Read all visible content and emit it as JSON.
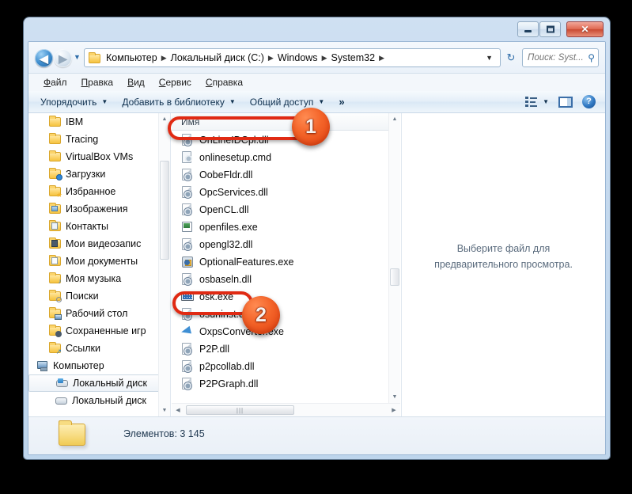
{
  "window": {
    "controls": {
      "minimize_label": "—",
      "maximize_label": "□",
      "close_label": "✕"
    }
  },
  "address_bar": {
    "back_label": "◀",
    "forward_label": "▶",
    "recent_label": "▼",
    "dropdown_label": "▼",
    "refresh_label": "↻",
    "breadcrumbs": [
      "Компьютер",
      "Локальный диск (C:)",
      "Windows",
      "System32"
    ],
    "separator": "▶",
    "search": {
      "placeholder": "Поиск: Syst...",
      "value": "",
      "icon": "search-icon"
    }
  },
  "menu": {
    "items": [
      {
        "accel": "Ф",
        "rest": "айл"
      },
      {
        "accel": "П",
        "rest": "равка"
      },
      {
        "accel": "В",
        "rest": "ид"
      },
      {
        "accel": "С",
        "rest": "ервис"
      },
      {
        "accel": "С",
        "rest": "правка"
      }
    ]
  },
  "toolbar": {
    "organize_label": "Упорядочить",
    "add_to_library_label": "Добавить в библиотеку",
    "share_label": "Общий доступ",
    "overflow_label": "»",
    "caret": "▼",
    "view_icon": "view-list-icon",
    "view_caret": "▼",
    "preview_pane_icon": "preview-pane-icon",
    "help_icon": "help-icon",
    "help_glyph": "?"
  },
  "nav_pane": {
    "items": [
      {
        "label": "IBM",
        "icon": "folder-icon",
        "indent": 1,
        "selected": false
      },
      {
        "label": "Tracing",
        "icon": "folder-icon",
        "indent": 1,
        "selected": false
      },
      {
        "label": "VirtualBox VMs",
        "icon": "folder-icon",
        "indent": 1,
        "selected": false
      },
      {
        "label": "Загрузки",
        "icon": "folder-downloads-icon",
        "indent": 1,
        "selected": false
      },
      {
        "label": "Избранное",
        "icon": "folder-favorites-icon",
        "indent": 1,
        "selected": false
      },
      {
        "label": "Изображения",
        "icon": "folder-pictures-icon",
        "indent": 1,
        "selected": false
      },
      {
        "label": "Контакты",
        "icon": "folder-contacts-icon",
        "indent": 1,
        "selected": false
      },
      {
        "label": "Мои видеозапис",
        "icon": "folder-videos-icon",
        "indent": 1,
        "selected": false
      },
      {
        "label": "Мои документы",
        "icon": "folder-documents-icon",
        "indent": 1,
        "selected": false
      },
      {
        "label": "Моя музыка",
        "icon": "folder-music-icon",
        "indent": 1,
        "selected": false
      },
      {
        "label": "Поиски",
        "icon": "folder-searches-icon",
        "indent": 1,
        "selected": false
      },
      {
        "label": "Рабочий стол",
        "icon": "folder-desktop-icon",
        "indent": 1,
        "selected": false
      },
      {
        "label": "Сохраненные игр",
        "icon": "folder-savedgames-icon",
        "indent": 1,
        "selected": false
      },
      {
        "label": "Ссылки",
        "icon": "folder-links-icon",
        "indent": 1,
        "selected": false
      },
      {
        "label": "Компьютер",
        "icon": "computer-icon",
        "indent": 0,
        "selected": false
      },
      {
        "label": "Локальный диск",
        "icon": "system-drive-icon",
        "indent": 2,
        "selected": true
      },
      {
        "label": "Локальный диск",
        "icon": "drive-icon",
        "indent": 2,
        "selected": false
      }
    ],
    "scroll_up": "▲",
    "scroll_down": "▼"
  },
  "file_list": {
    "column_header": "Имя",
    "rows": [
      {
        "name": "OnLineIDCpl.dll",
        "icon": "dll-icon"
      },
      {
        "name": "onlinesetup.cmd",
        "icon": "cmd-icon"
      },
      {
        "name": "OobeFldr.dll",
        "icon": "dll-icon"
      },
      {
        "name": "OpcServices.dll",
        "icon": "dll-icon"
      },
      {
        "name": "OpenCL.dll",
        "icon": "dll-icon"
      },
      {
        "name": "openfiles.exe",
        "icon": "console-exe-icon"
      },
      {
        "name": "opengl32.dll",
        "icon": "dll-icon"
      },
      {
        "name": "OptionalFeatures.exe",
        "icon": "optional-features-icon"
      },
      {
        "name": "osbaseln.dll",
        "icon": "dll-icon"
      },
      {
        "name": "osk.exe",
        "icon": "keyboard-icon"
      },
      {
        "name": "osuninst.dll",
        "icon": "dll-icon"
      },
      {
        "name": "OxpsConverter.exe",
        "icon": "paper-plane-icon"
      },
      {
        "name": "P2P.dll",
        "icon": "dll-icon"
      },
      {
        "name": "p2pcollab.dll",
        "icon": "dll-icon"
      },
      {
        "name": "P2PGraph.dll",
        "icon": "dll-icon"
      }
    ],
    "scroll_up": "▲",
    "scroll_down": "▼",
    "scroll_left": "◀",
    "scroll_right": "▶",
    "hthumb_grip": "|||"
  },
  "preview_pane": {
    "message": "Выберите файл для предварительного просмотра."
  },
  "details_pane": {
    "icon": "folder-icon",
    "text": "Элементов: 3 145"
  },
  "annotations": {
    "badges": [
      {
        "number": "1",
        "target": "column-header-name"
      },
      {
        "number": "2",
        "target": "file-row-osk-exe"
      }
    ],
    "highlight_color": "#e02a13"
  },
  "colors": {
    "accent": "#2d6ca8",
    "annotation_red": "#e02a13",
    "badge_orange": "#f4652a",
    "window_frame": "#c6daef",
    "background": "#000000"
  }
}
